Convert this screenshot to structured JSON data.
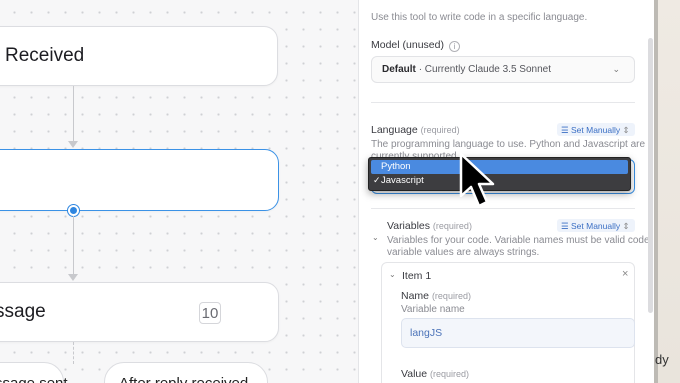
{
  "canvas": {
    "node1_label": "Received",
    "node2_label": "",
    "node3_label": "ssage",
    "node3_badge": "10",
    "pill1_label": "ssage sent",
    "pill2_label": "After reply received"
  },
  "panel": {
    "description": "Use this tool to write code in a specific language.",
    "model_label": "Model (unused)",
    "model_info_icon": "info-icon",
    "model_value_bold": "Default",
    "model_value_rest": "· Currently Claude 3.5 Sonnet",
    "language_label": "Language",
    "language_required": "(required)",
    "set_manually": "Set Manually",
    "language_desc_line1": "The programming language to use. Python and Javascript are",
    "language_desc_line2": "currently supported.",
    "dropdown_options": [
      "Python",
      "Javascript"
    ],
    "dropdown_highlighted": "Python",
    "dropdown_checked": "Javascript",
    "variables_label": "Variables",
    "variables_required": "(required)",
    "variables_set_manually": "Set Manually",
    "variables_desc_line1": "Variables for your code. Variable names must be valid code, and",
    "variables_desc_line2": "variable values are always strings.",
    "item_label": "Item 1",
    "name_label": "Name",
    "name_required": "(required)",
    "name_desc": "Variable name",
    "name_value": "langJS",
    "value_label": "Value",
    "value_required": "(required)"
  },
  "edge_text": "dy",
  "colors": {
    "accent": "#3b92e6",
    "dropdown_bg": "#3d3d40",
    "highlight": "#4a8ae0"
  }
}
